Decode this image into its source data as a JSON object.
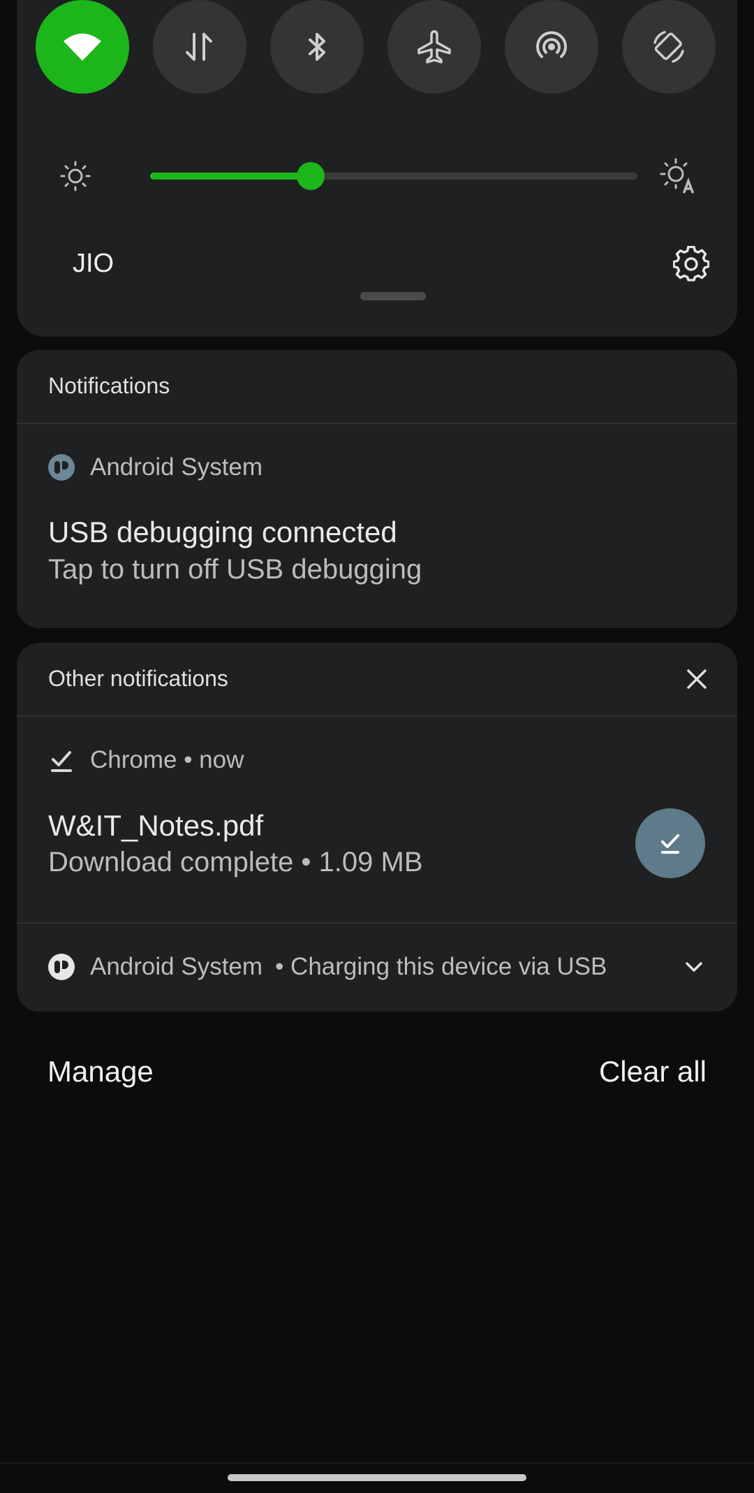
{
  "quick_settings": {
    "tiles": [
      {
        "name": "wifi",
        "active": true
      },
      {
        "name": "mobile-data",
        "active": false
      },
      {
        "name": "bluetooth",
        "active": false
      },
      {
        "name": "airplane-mode",
        "active": false
      },
      {
        "name": "hotspot",
        "active": false
      },
      {
        "name": "auto-rotate",
        "active": false
      }
    ],
    "brightness_level": 0.33,
    "carrier": "JIO"
  },
  "notifications_card": {
    "header": "Notifications",
    "app_name": "Android System",
    "title": "USB debugging connected",
    "subtitle": "Tap to turn off USB debugging"
  },
  "other_card": {
    "header": "Other notifications",
    "chrome": {
      "app_line": "Chrome • now",
      "title": "W&IT_Notes.pdf",
      "subtitle": "Download complete • 1.09 MB"
    },
    "android_collapsed": {
      "app_name": "Android System",
      "text": "• Charging this device via USB"
    }
  },
  "footer": {
    "manage_label": "Manage",
    "clear_all_label": "Clear all"
  },
  "colors": {
    "accent": "#1db61a",
    "panel": "#1f2022",
    "background": "#0c0c0c",
    "download_button": "#5e7b8a"
  }
}
